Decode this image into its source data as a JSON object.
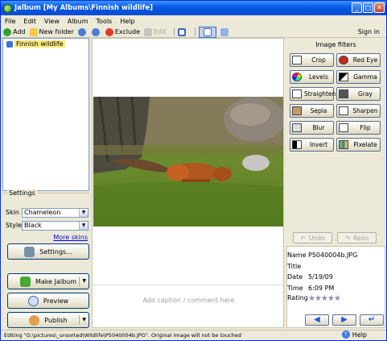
{
  "window": {
    "title": "Jalbum [My Albums\\Finnish wildlife]"
  },
  "menu": [
    "File",
    "Edit",
    "View",
    "Album",
    "Tools",
    "Help"
  ],
  "toolbar": {
    "add": "Add",
    "new_folder": "New folder",
    "exclude": "Exclude",
    "edit": "Edit",
    "sign_in": "Sign in"
  },
  "tree": {
    "root": "Finnish wildlife"
  },
  "settings": {
    "title": "Settings",
    "skin_label": "Skin",
    "skin_value": "Chameleon",
    "style_label": "Style",
    "style_value": "Black",
    "more_skins": "More skins",
    "settings_button": "Settings...",
    "make_button": "Make Jalbum",
    "preview_button": "Preview",
    "publish_button": "Publish"
  },
  "filters": {
    "title": "Image filters",
    "items": [
      "Crop",
      "Red Eye",
      "Levels",
      "Gamma",
      "Straighten",
      "Gray",
      "Sepia",
      "Sharpen",
      "Blur",
      "Flip",
      "Invert",
      "Pixelate"
    ],
    "undo": "Undo",
    "redo": "Redo"
  },
  "info": {
    "name_label": "Name",
    "name": "P5040004b.JPG",
    "title_label": "Title",
    "title": "",
    "date_label": "Date",
    "date": "5/19/09",
    "time_label": "Time",
    "time": "6:09 PM",
    "rating_label": "Rating",
    "rating": 0
  },
  "caption_placeholder": "Add caption / comment here",
  "status": "Editing \"G:\\pictures\\_unsorted\\Wildlife\\P5040004b.JPG\". Original image will not be touched",
  "help": "Help"
}
